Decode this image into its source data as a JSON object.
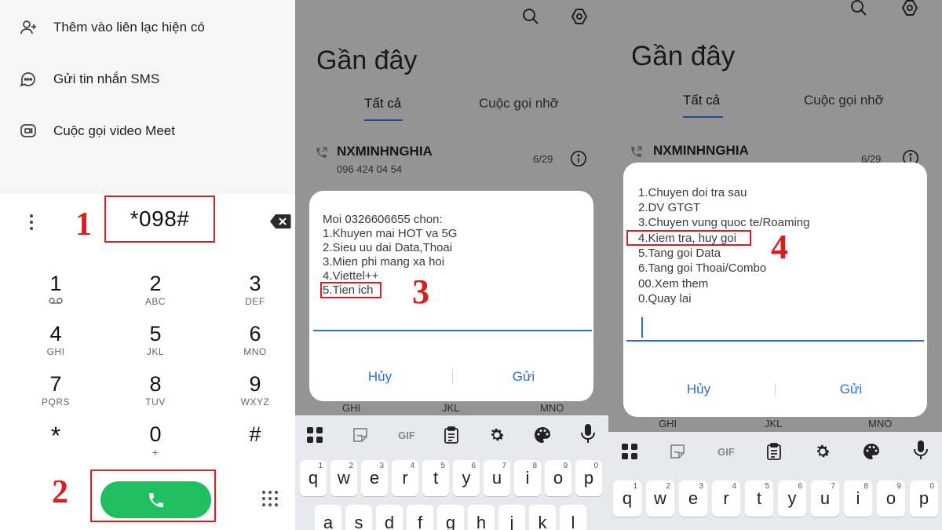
{
  "panel1": {
    "menu": [
      {
        "label": "Thêm vào liên lạc hiện có",
        "icon": "add-person-icon"
      },
      {
        "label": "Gửi tin nhắn SMS",
        "icon": "message-icon"
      },
      {
        "label": "Cuộc gọi video Meet",
        "icon": "video-call-icon"
      }
    ],
    "dialed_number": "*098#",
    "step_labels": [
      "1",
      "2"
    ],
    "keypad": [
      {
        "digit": "1",
        "sub": "ω"
      },
      {
        "digit": "2",
        "sub": "ABC"
      },
      {
        "digit": "3",
        "sub": "DEF"
      },
      {
        "digit": "4",
        "sub": "GHI"
      },
      {
        "digit": "5",
        "sub": "JKL"
      },
      {
        "digit": "6",
        "sub": "MNO"
      },
      {
        "digit": "7",
        "sub": "PQRS"
      },
      {
        "digit": "8",
        "sub": "TUV"
      },
      {
        "digit": "9",
        "sub": "WXYZ"
      },
      {
        "digit": "*",
        "sub": ""
      },
      {
        "digit": "0",
        "sub": "+"
      },
      {
        "digit": "#",
        "sub": ""
      }
    ]
  },
  "panel2": {
    "title": "Gần đây",
    "tabs": [
      "Tất cả",
      "Cuộc gọi nhỡ"
    ],
    "contact_name": "NXMINHNGHIA",
    "contact_number": "096 424 04 54",
    "call_date": "6/29",
    "dialog": {
      "lines": [
        "Moi 0326606655 chon:",
        "1.Khuyen mai HOT va 5G",
        "2.Sieu uu dai Data,Thoai",
        "3.Mien phi mang xa hoi",
        "4.Viettel++",
        "5.Tien ich"
      ],
      "cancel": "Hủy",
      "send": "Gửi"
    },
    "step_label": "3",
    "keypad_strip": [
      "GHI",
      "JKL",
      "MNO"
    ]
  },
  "panel3": {
    "title": "Gần đây",
    "tabs": [
      "Tất cả",
      "Cuộc gọi nhỡ"
    ],
    "contact_name": "NXMINHNGHIA",
    "call_date": "6/29",
    "dialog": {
      "lines": [
        "1.Chuyen doi tra sau",
        "2.DV GTGT",
        "3.Chuyen vung quoc te/Roaming",
        "4.Kiem tra, huy goi",
        "5.Tang goi Data",
        "6.Tang goi Thoai/Combo",
        "00.Xem them",
        "0.Quay lai"
      ],
      "cancel": "Hủy",
      "send": "Gửi"
    },
    "step_label": "4",
    "keypad_strip": [
      "GHI",
      "JKL",
      "MNO"
    ]
  },
  "keyboard": {
    "toolbar_icons": [
      "apps-grid-icon",
      "sticker-icon",
      "gif-icon",
      "clipboard-icon",
      "settings-gear-icon",
      "palette-icon",
      "microphone-icon"
    ],
    "gif_label": "GIF",
    "row1": [
      {
        "key": "q",
        "hint": "1"
      },
      {
        "key": "w",
        "hint": "2"
      },
      {
        "key": "e",
        "hint": "3"
      },
      {
        "key": "r",
        "hint": "4"
      },
      {
        "key": "t",
        "hint": "5"
      },
      {
        "key": "y",
        "hint": "6"
      },
      {
        "key": "u",
        "hint": "7"
      },
      {
        "key": "i",
        "hint": "8"
      },
      {
        "key": "o",
        "hint": "9"
      },
      {
        "key": "p",
        "hint": "0"
      }
    ],
    "row2": [
      "a",
      "s",
      "d",
      "f",
      "g",
      "h",
      "j",
      "k",
      "l"
    ]
  },
  "colors": {
    "accent_blue": "#2f6bd0",
    "call_green": "#1fbe5e",
    "annotation_red": "#d81f1f",
    "dim_overlay": "#949494"
  }
}
